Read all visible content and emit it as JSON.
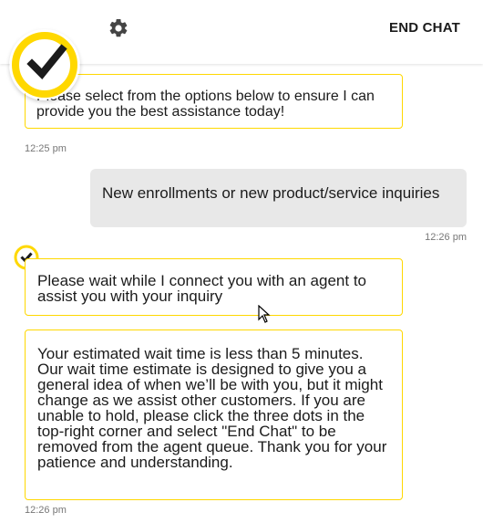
{
  "header": {
    "settings_icon": "gear-icon",
    "end_chat_label": "END CHAT"
  },
  "brand": {
    "logo_icon": "checkmark-logo-icon",
    "color_accent": "#ffd800"
  },
  "messages": [
    {
      "from": "bot",
      "text": "Please select from the options below to ensure I can provide you the best assistance today!",
      "time": "12:25 pm"
    },
    {
      "from": "user",
      "text": "New enrollments or new product/service inquiries",
      "time": "12:26 pm"
    },
    {
      "from": "bot",
      "text": "Please wait while I connect you with an agent to assist you with your inquiry"
    },
    {
      "from": "bot",
      "text": "Your estimated wait time is less than 5 minutes. Our wait time estimate is designed to give you a general idea of when we’ll be with you, but it might change as we assist other customers. If you are unable to hold, please click the three dots in the top-right corner and select \"End Chat\" to be removed from the agent queue. Thank you for your patience and understanding.",
      "time": "12:26 pm"
    }
  ],
  "colors": {
    "bot_border": "#ffd800",
    "user_bubble": "#e8e8e8"
  }
}
